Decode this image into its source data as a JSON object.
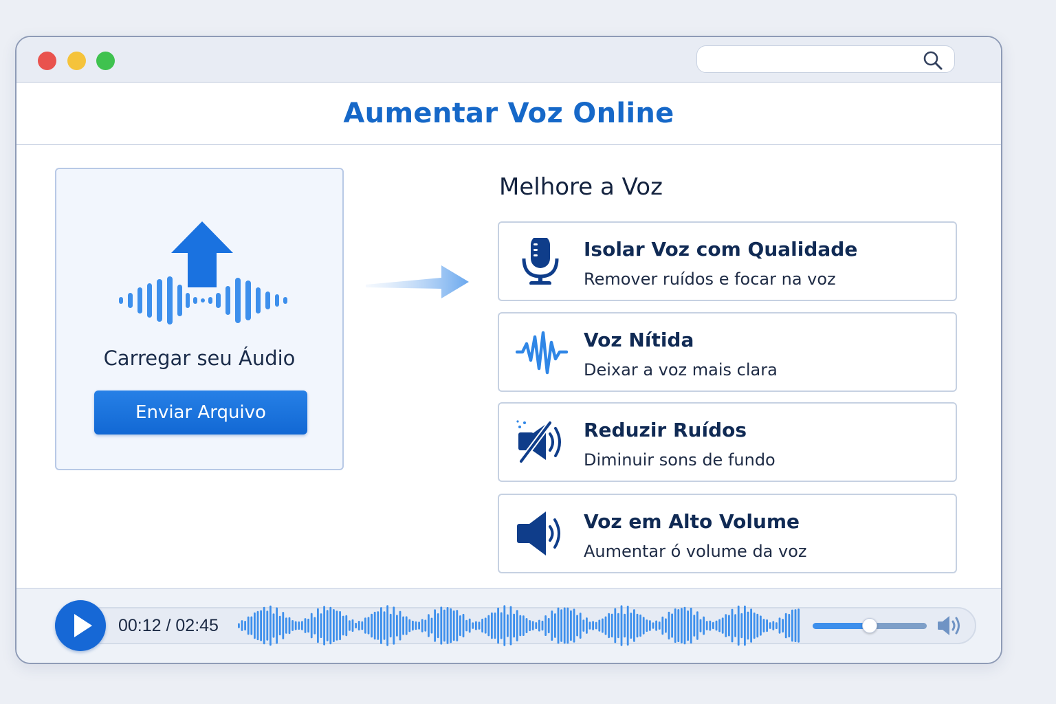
{
  "window": {
    "controls": [
      "close",
      "minimize",
      "maximize"
    ],
    "search": {
      "placeholder": "",
      "icon": "search-icon"
    }
  },
  "header": {
    "title": "Aumentar Voz Online"
  },
  "upload": {
    "label": "Carregar seu Áudio",
    "button_label": "Enviar Arquivo",
    "icon": "upload-arrow-icon"
  },
  "enhance": {
    "title": "Melhore a Voz",
    "options": [
      {
        "title": "Isolar Voz com Qualidade",
        "subtitle": "Remover ruídos e focar na voz",
        "icon": "microphone-icon"
      },
      {
        "title": "Voz Nítida",
        "subtitle": "Deixar a voz mais clara",
        "icon": "waveform-icon"
      },
      {
        "title": "Reduzir Ruídos",
        "subtitle": "Diminuir sons de fundo",
        "icon": "noise-reduction-icon"
      },
      {
        "title": "Voz em Alto Volume",
        "subtitle": "Aumentar ó volume da voz",
        "icon": "speaker-loud-icon"
      }
    ]
  },
  "player": {
    "time": "00:12 / 02:45",
    "volume_level": 0.5,
    "icons": [
      "play-icon",
      "volume-icon"
    ]
  },
  "colors": {
    "accent": "#1668c8",
    "navy": "#0f3d8a",
    "wave": "#3d8fec",
    "close": "#e9534e",
    "minimize": "#f5c33b",
    "maximize": "#3fc24f"
  }
}
